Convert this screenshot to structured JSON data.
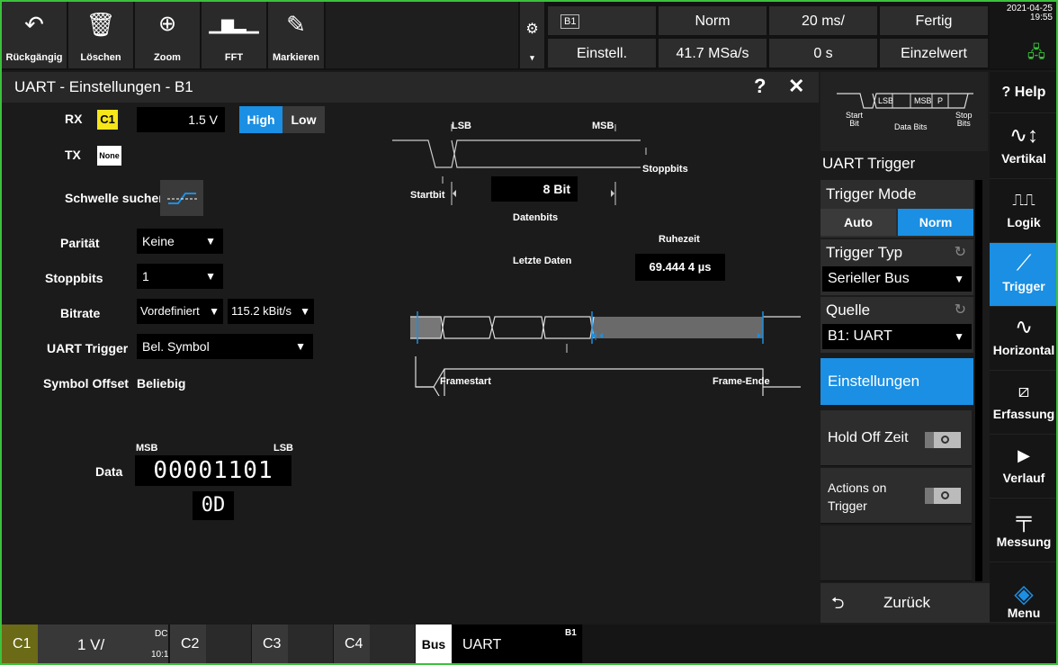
{
  "toolbar": {
    "undo_label": "Rückgängig",
    "delete_label": "Löschen",
    "zoom_label": "Zoom",
    "fft_label": "FFT",
    "mark_label": "Markieren"
  },
  "status": {
    "bus_tag": "B1",
    "settings": "Einstell.",
    "trigger_mode": "Norm",
    "sample_rate": "41.7 MSa/s",
    "time_scale": "20 ms/",
    "time_offset": "0 s",
    "acq_state": "Fertig",
    "acq_mode": "Einzelwert",
    "datetime": "2021-04-25\n19:55"
  },
  "dialog": {
    "title": "UART - Einstellungen - B1",
    "help": "?",
    "close": "✕",
    "rx_label": "RX",
    "rx_channel": "C1",
    "rx_threshold": "1.5 V",
    "polarity_high": "High",
    "polarity_low": "Low",
    "tx_label": "TX",
    "tx_channel": "None",
    "find_threshold_label": "Schwelle suchen",
    "parity_label": "Parität",
    "parity_value": "Keine",
    "stopbits_label": "Stoppbits",
    "stopbits_value": "1",
    "bitrate_label": "Bitrate",
    "bitrate_mode": "Vordefiniert",
    "bitrate_value": "115.2 kBit/s",
    "uart_trigger_label": "UART Trigger",
    "uart_trigger_value": "Bel. Symbol",
    "symbol_offset_label": "Symbol Offset",
    "symbol_offset_value": "Beliebig",
    "data_label": "Data",
    "data_msb": "MSB",
    "data_lsb": "LSB",
    "data_bits": "00001101",
    "data_hex": "0D"
  },
  "diagram": {
    "lsb": "LSB",
    "msb": "MSB",
    "stopbits": "Stoppbits",
    "startbit": "Startbit",
    "databits_value": "8 Bit",
    "databits_label": "Datenbits",
    "idle_label": "Ruhezeit",
    "last_data": "Letzte Daten",
    "idle_value": "69.444 4 µs",
    "framestart": "Framestart",
    "frameend": "Frame-Ende"
  },
  "panel": {
    "diagram_start": "Start\nBit",
    "diagram_data": "Data Bits",
    "diagram_stop": "Stop\nBits",
    "diagram_lsb": "LSB",
    "diagram_msb": "MSB",
    "diagram_p": "P",
    "header": "UART Trigger",
    "trigger_mode_label": "Trigger Mode",
    "mode_auto": "Auto",
    "mode_norm": "Norm",
    "trigger_type_label": "Trigger Typ",
    "trigger_type_value": "Serieller Bus",
    "source_label": "Quelle",
    "source_value": "B1: UART",
    "settings_button": "Einstellungen",
    "holdoff_label": "Hold Off Zeit",
    "actions_label": "Actions on\nTrigger",
    "back_label": "Zurück"
  },
  "sidebar": {
    "help": "Help",
    "vertical": "Vertikal",
    "logic": "Logik",
    "trigger": "Trigger",
    "horizontal": "Horizontal",
    "acquisition": "Erfassung",
    "history": "Verlauf",
    "measure": "Messung",
    "menu": "Menu"
  },
  "bottom": {
    "c1": "C1",
    "c1_scale": "1 V/",
    "c1_coupling": "DC",
    "c1_impedance": "10:1",
    "c2": "C2",
    "c3": "C3",
    "c4": "C4",
    "bus_label": "Bus",
    "bus_protocol": "UART",
    "bus_tag": "B1"
  },
  "colors": {
    "accent": "#1a8fe3",
    "c1_yellow": "#f5e51a",
    "frame_green": "#3cc23c",
    "active_blue": "#1a8fe3"
  }
}
